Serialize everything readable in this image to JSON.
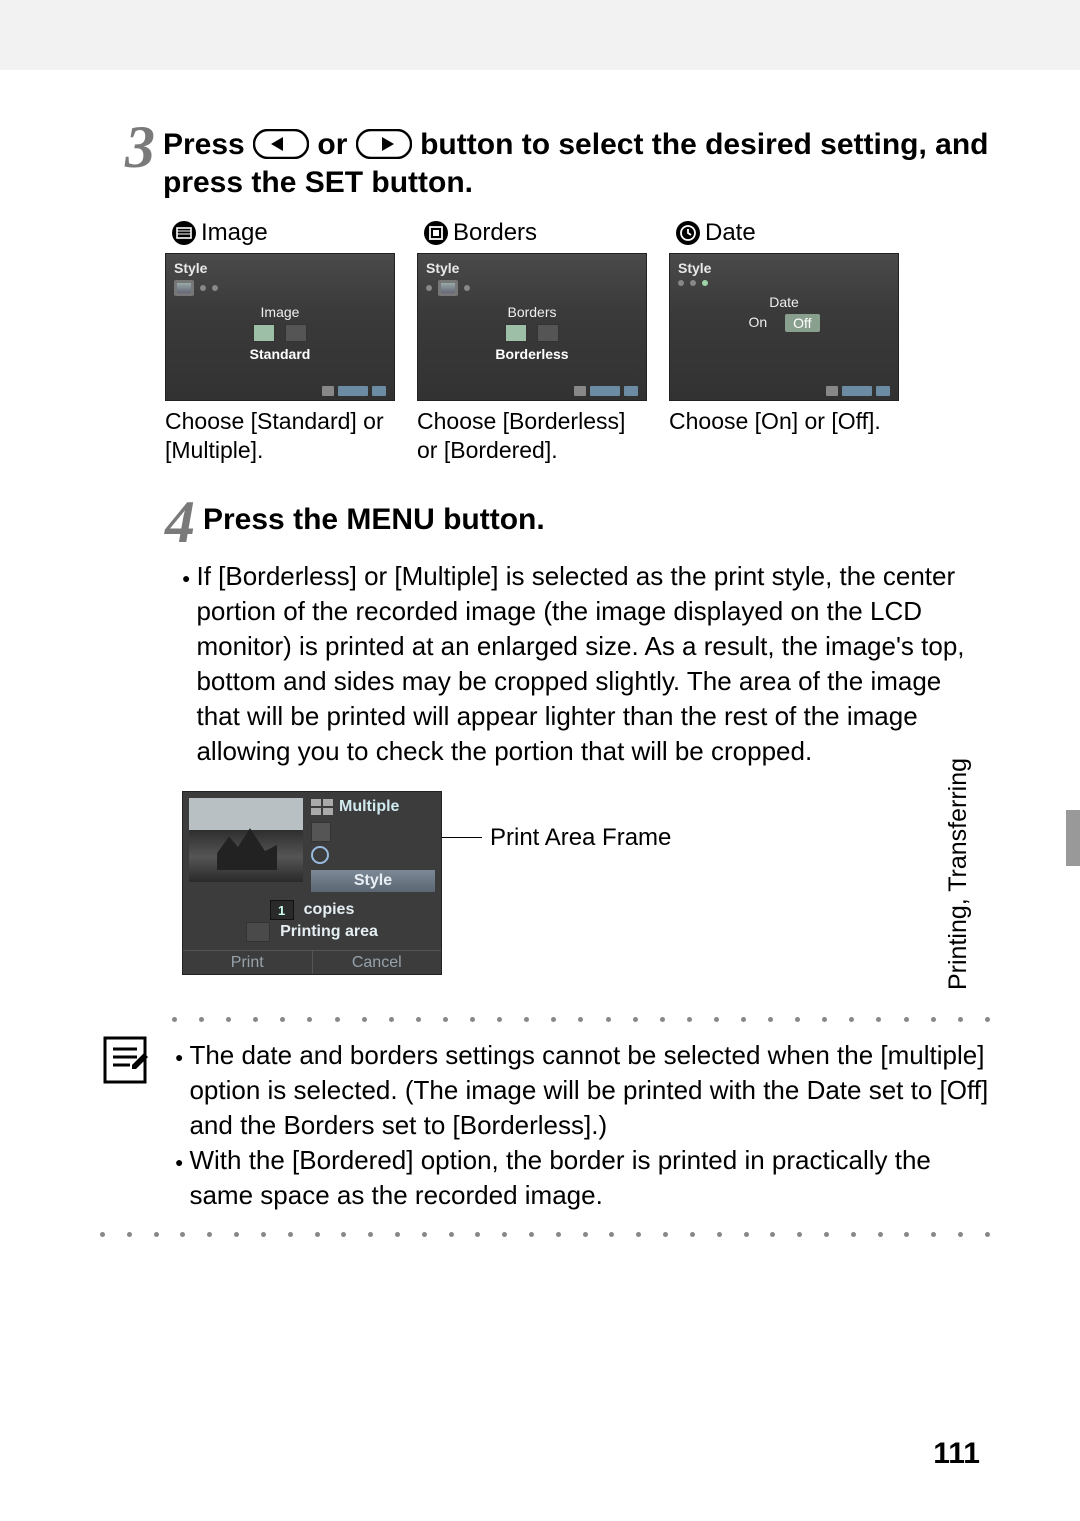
{
  "step3": {
    "number": "3",
    "title_a": "Press ",
    "title_b": " or ",
    "title_c": " button to select the desired setting, and press the SET button."
  },
  "thumbs": {
    "image": {
      "label": "Image",
      "lcd_top": "Style",
      "lcd_heading": "Image",
      "lcd_value": "Standard",
      "caption": "Choose [Standard] or [Multiple]."
    },
    "borders": {
      "label": "Borders",
      "lcd_top": "Style",
      "lcd_heading": "Borders",
      "lcd_value": "Borderless",
      "caption": "Choose [Borderless] or [Bordered]."
    },
    "date": {
      "label": "Date",
      "lcd_top": "Style",
      "lcd_heading": "Date",
      "lcd_on": "On",
      "lcd_off": "Off",
      "caption": "Choose [On] or [Off]."
    }
  },
  "step4": {
    "number": "4",
    "title": "Press the MENU button.",
    "bullet": "If [Borderless] or [Multiple] is selected as the print style, the center portion of the recorded image (the image displayed on the LCD monitor) is printed at an enlarged size. As a result, the image's top, bottom and sides may be cropped slightly. The area of the image that will be printed will appear lighter than the rest of the image allowing you to check the portion that will be cropped."
  },
  "print_lcd": {
    "multiple": "Multiple",
    "style": "Style",
    "count": "1",
    "copies": "copies",
    "printing_area": "Printing area",
    "print": "Print",
    "cancel": "Cancel",
    "leader_label": "Print Area Frame"
  },
  "note": {
    "b1": "The date and borders settings cannot be selected when the [multiple] option is selected. (The image will be printed with the Date set to [Off] and the Borders set to [Borderless].)",
    "b2": "With the [Bordered] option, the border is printed in practically the same space as the recorded image."
  },
  "side_tab": "Printing, Transferring",
  "page_number": "111"
}
